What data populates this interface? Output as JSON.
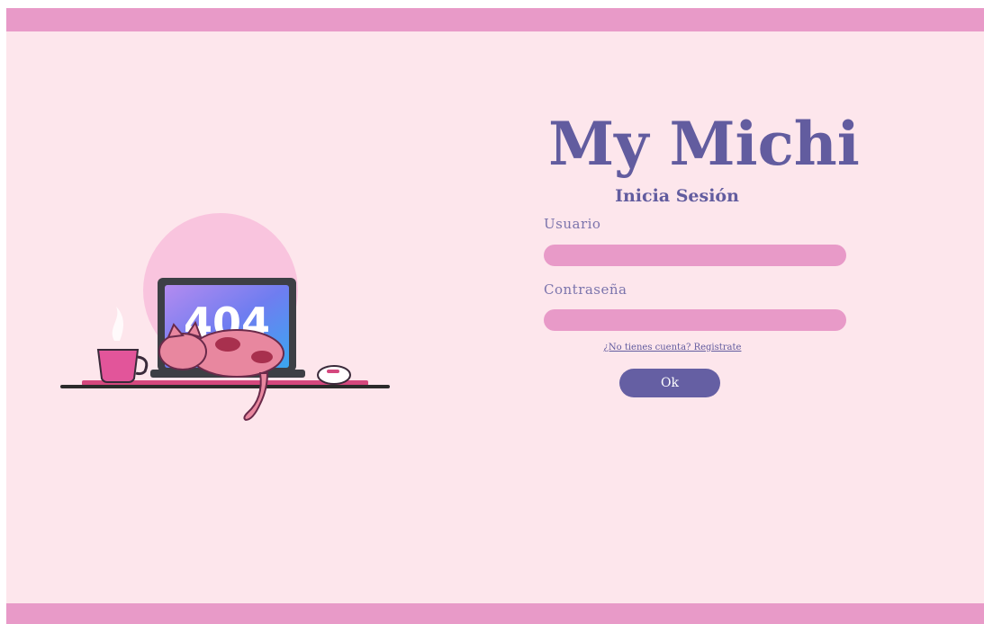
{
  "app": {
    "title": "My Michi",
    "subtitle": "Inicia Sesión"
  },
  "form": {
    "user_label": "Usuario",
    "user_value": "",
    "password_label": "Contraseña",
    "password_value": "",
    "register_link": "¿No tienes cuenta? Registrate",
    "submit_label": "Ok"
  },
  "illustration": {
    "screen_text": "404",
    "description_icon": "sleeping-cat-on-laptop-icon"
  },
  "colors": {
    "background": "#fde6ec",
    "bar": "#e89ac8",
    "accent": "#625c9f",
    "input": "#e89ac8",
    "button": "#655fa3"
  }
}
